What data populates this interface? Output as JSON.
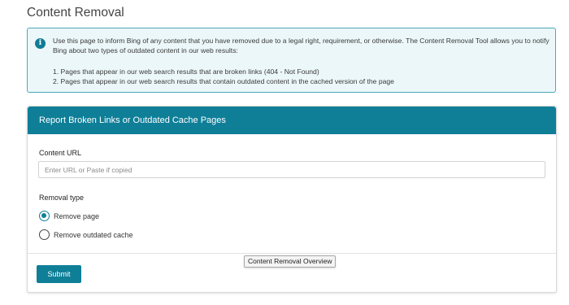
{
  "page": {
    "title": "Content Removal"
  },
  "info": {
    "icon": "info-icon",
    "text": "Use this page to inform Bing of any content that you have removed due to a legal right, requirement, or otherwise. The Content Removal Tool allows you to notify Bing about two types of outdated content in our web results:",
    "items": [
      "1. Pages that appear in our web search results that are broken links (404 - Not Found)",
      "2. Pages that appear in our web search results that contain outdated content in the cached version of the page"
    ]
  },
  "card": {
    "header": "Report Broken Links or Outdated Cache Pages",
    "url_label": "Content URL",
    "url_placeholder": "Enter URL or Paste if copied",
    "url_value": "",
    "removal_label": "Removal type",
    "options": [
      {
        "label": "Remove page",
        "selected": true
      },
      {
        "label": "Remove outdated cache",
        "selected": false
      }
    ],
    "submit_label": "Submit"
  },
  "tooltip": {
    "text": "Content Removal Overview"
  },
  "colors": {
    "accent": "#0f7f98",
    "info_bg": "#ecf7f9",
    "info_border": "#4aa8b8"
  }
}
